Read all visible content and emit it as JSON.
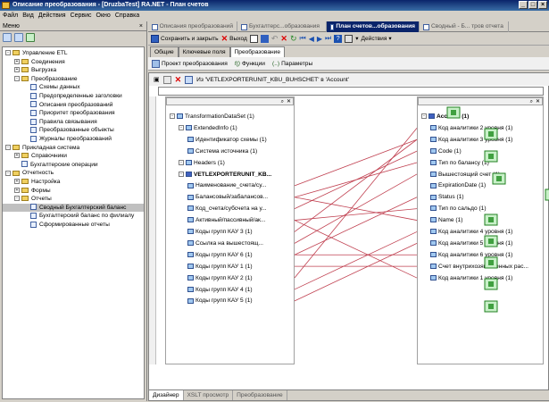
{
  "window": {
    "title": "Описание преобразования - [DruzbaTest] RA.NET - План счетов"
  },
  "menu": [
    "Файл",
    "Вид",
    "Действия",
    "Сервис",
    "Окно",
    "Справка"
  ],
  "left_panel": {
    "header": "Меню",
    "tree": [
      {
        "label": "Управление ETL",
        "level": 0,
        "expand": "-",
        "icon": "folder"
      },
      {
        "label": "Соединения",
        "level": 1,
        "expand": "+",
        "icon": "folder"
      },
      {
        "label": "Выгрузка",
        "level": 1,
        "expand": "+",
        "icon": "folder"
      },
      {
        "label": "Преобразование",
        "level": 1,
        "expand": "-",
        "icon": "folder"
      },
      {
        "label": "Схемы данных",
        "level": 2,
        "icon": "doc"
      },
      {
        "label": "Предопределенные заголовки",
        "level": 2,
        "icon": "doc"
      },
      {
        "label": "Описания преобразований",
        "level": 2,
        "icon": "doc"
      },
      {
        "label": "Приоритет преобразования",
        "level": 2,
        "icon": "doc"
      },
      {
        "label": "Правила связывания",
        "level": 2,
        "icon": "doc"
      },
      {
        "label": "Преобразованные объекты",
        "level": 2,
        "icon": "doc"
      },
      {
        "label": "Журналы преобразований",
        "level": 2,
        "icon": "doc"
      },
      {
        "label": "Прикладная система",
        "level": 0,
        "expand": "-",
        "icon": "folder"
      },
      {
        "label": "Справочники",
        "level": 1,
        "expand": "+",
        "icon": "folder"
      },
      {
        "label": "Бухгалтерские операции",
        "level": 1,
        "icon": "doc"
      },
      {
        "label": "Отчетность",
        "level": 0,
        "expand": "-",
        "icon": "folder"
      },
      {
        "label": "Настройка",
        "level": 1,
        "expand": "+",
        "icon": "folder"
      },
      {
        "label": "Формы",
        "level": 1,
        "expand": "+",
        "icon": "folder"
      },
      {
        "label": "Отчеты",
        "level": 1,
        "expand": "-",
        "icon": "folder"
      },
      {
        "label": "Сводный Бухгалтерский баланс",
        "level": 2,
        "icon": "doc",
        "selected": true
      },
      {
        "label": "Бухгалтерский баланс по филиалу",
        "level": 2,
        "icon": "doc"
      },
      {
        "label": "Сформированные отчеты",
        "level": 2,
        "icon": "doc"
      }
    ]
  },
  "doc_tabs": [
    "Описания преобразований",
    "Бухгалтерс...образования",
    "План счетов...образования",
    "Сводный - Б... тров отчета"
  ],
  "toolbar": {
    "save_close": "Сохранить и закрыть",
    "exit": "Выход",
    "actions": "Действия"
  },
  "sub_tabs": [
    "Общие",
    "Ключевые поля",
    "Преобразование"
  ],
  "toolbar2": {
    "project": "Проект преобразования",
    "functions": "Функции",
    "params": "Параметры"
  },
  "filter_text": "Из 'VETLEXPORTERUNIT_KBU_BUHSCHET' в 'Account'",
  "source_tree": [
    {
      "label": "TransformationDataSet (1)",
      "level": 0,
      "bold": false
    },
    {
      "label": "ExtendedInfo (1)",
      "level": 1,
      "bold": false
    },
    {
      "label": "Идентификатор схемы (1)",
      "level": 2,
      "bold": false
    },
    {
      "label": "Система источника (1)",
      "level": 2,
      "bold": false
    },
    {
      "label": "Headers (1)",
      "level": 1,
      "bold": false
    },
    {
      "label": "VETLEXPORTERUNIT_KB...",
      "level": 1,
      "bold": true
    },
    {
      "label": "Наименование_счета/су...",
      "level": 2,
      "bold": false
    },
    {
      "label": "Балансовый/забалансов...",
      "level": 2,
      "bold": false
    },
    {
      "label": "Код_счета/субсчета на у...",
      "level": 2,
      "bold": false
    },
    {
      "label": "Активный/пассивный/ак...",
      "level": 2,
      "bold": false
    },
    {
      "label": "Коды групп КАУ 3 (1)",
      "level": 2,
      "bold": false
    },
    {
      "label": "Ссылка на вышестоящ...",
      "level": 2,
      "bold": false
    },
    {
      "label": "Коды групп КАУ 6 (1)",
      "level": 2,
      "bold": false
    },
    {
      "label": "Коды групп КАУ 1 (1)",
      "level": 2,
      "bold": false
    },
    {
      "label": "Коды групп КАУ 2 (1)",
      "level": 2,
      "bold": false
    },
    {
      "label": "Коды групп КАУ 4 (1)",
      "level": 2,
      "bold": false
    },
    {
      "label": "Коды групп КАУ 5 (1)",
      "level": 2,
      "bold": false
    }
  ],
  "target_tree": [
    {
      "label": "Account (1)",
      "level": 0,
      "bold": true
    },
    {
      "label": "Код аналитики 2 уровня (1)",
      "level": 1,
      "bold": false
    },
    {
      "label": "Код аналитики 3 уровня (1)",
      "level": 1,
      "bold": false
    },
    {
      "label": "Code (1)",
      "level": 1,
      "bold": false
    },
    {
      "label": "Тип по балансу (1)",
      "level": 1,
      "bold": false
    },
    {
      "label": "Вышестоящий счет (1)",
      "level": 1,
      "bold": false
    },
    {
      "label": "ExpirationDate (1)",
      "level": 1,
      "bold": false
    },
    {
      "label": "Status (1)",
      "level": 1,
      "bold": false
    },
    {
      "label": "Тип по сальдо (1)",
      "level": 1,
      "bold": false
    },
    {
      "label": "Name (1)",
      "level": 1,
      "bold": false
    },
    {
      "label": "Код аналитики 4 уровня (1)",
      "level": 1,
      "bold": false
    },
    {
      "label": "Код аналитики 5 уровня (1)",
      "level": 1,
      "bold": false
    },
    {
      "label": "Код аналитики 6 уровня (1)",
      "level": 1,
      "bold": false
    },
    {
      "label": "Счет внутрихозяйственных рас...",
      "level": 1,
      "bold": false
    },
    {
      "label": "Код аналитики 1 уровня (1)",
      "level": 1,
      "bold": false
    }
  ],
  "bottom_tabs": [
    "Дизайнер",
    "XSLT просмотр",
    "Преобразование"
  ]
}
